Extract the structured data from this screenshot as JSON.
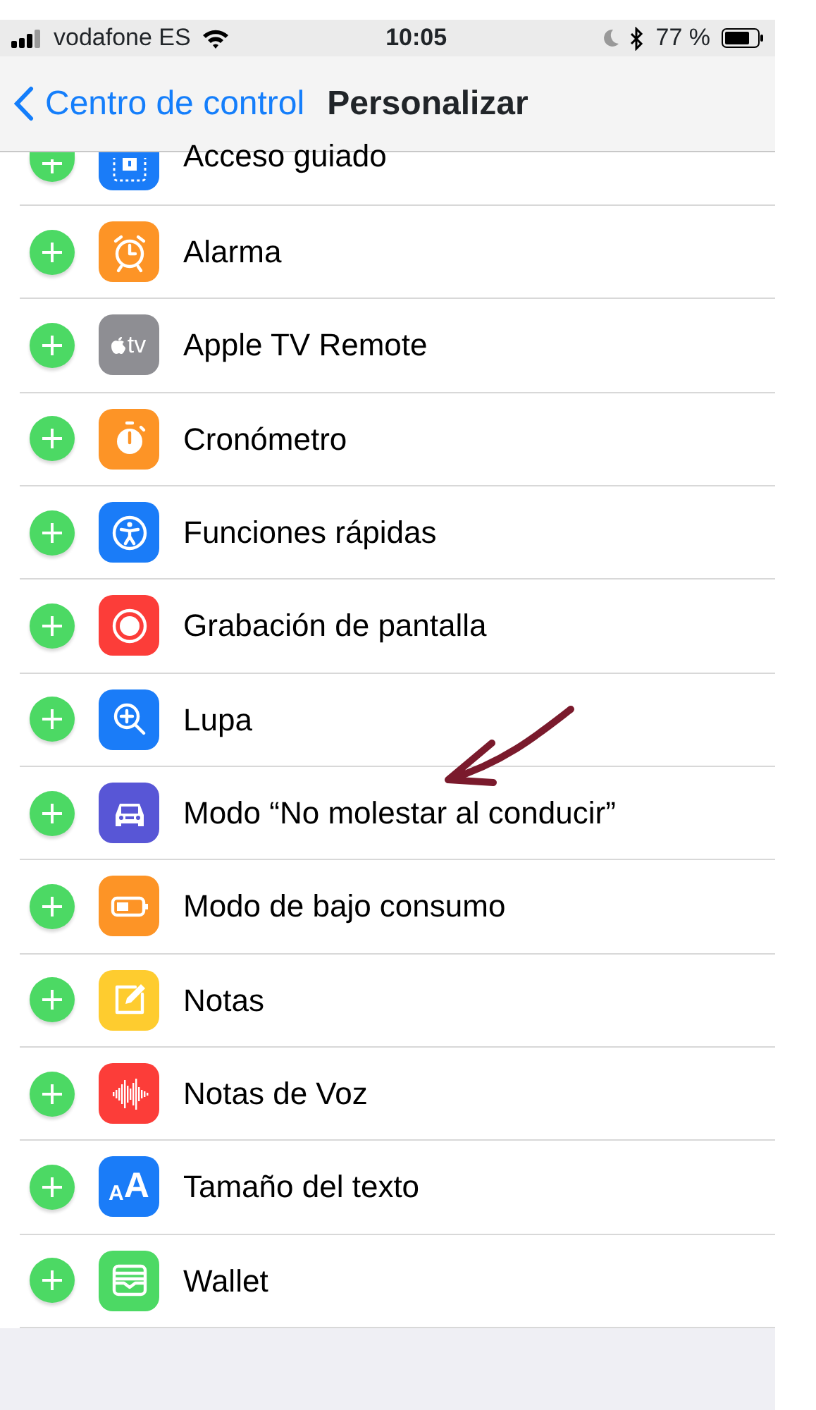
{
  "status_bar": {
    "carrier": "vodafone ES",
    "time": "10:05",
    "battery": "77 %"
  },
  "nav_bar": {
    "back": "Centro de control",
    "title": "Personalizar"
  },
  "items": [
    {
      "label": "Acceso guiado",
      "color": "#1a7cf8",
      "clipped": true
    },
    {
      "label": "Alarma",
      "color": "#fd9426",
      "clipped": false
    },
    {
      "label": "Apple TV Remote",
      "color": "#8e8e93",
      "clipped": false,
      "icon_text": "tv"
    },
    {
      "label": "Cronómetro",
      "color": "#fd9426",
      "clipped": false
    },
    {
      "label": "Funciones rápidas",
      "color": "#1a7cf8",
      "clipped": false
    },
    {
      "label": "Grabación de pantalla",
      "color": "#fc3d39",
      "clipped": false
    },
    {
      "label": "Lupa",
      "color": "#1a7cf8",
      "clipped": false
    },
    {
      "label": "Modo “No molestar al conducir”",
      "color": "#5856d6",
      "clipped": false
    },
    {
      "label": "Modo de bajo consumo",
      "color": "#fd9426",
      "clipped": false
    },
    {
      "label": "Notas",
      "color": "#fecc2f",
      "clipped": false
    },
    {
      "label": "Notas de Voz",
      "color": "#fc3d39",
      "clipped": false
    },
    {
      "label": "Tamaño del texto",
      "color": "#1a7cf8",
      "clipped": false,
      "icon_texts": [
        "A",
        "A"
      ]
    },
    {
      "label": "Wallet",
      "color": "#4cd964",
      "clipped": false
    }
  ]
}
